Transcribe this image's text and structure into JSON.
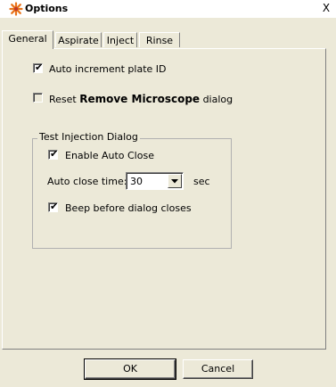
{
  "window": {
    "title": "Options",
    "close_glyph": "X"
  },
  "tabs": [
    {
      "label": "General",
      "active": true
    },
    {
      "label": "Aspirate",
      "active": false
    },
    {
      "label": "Inject",
      "active": false
    },
    {
      "label": "Rinse",
      "active": false
    }
  ],
  "general": {
    "auto_increment": {
      "label": "Auto increment plate ID",
      "checked": true
    },
    "reset": {
      "prefix": "Reset",
      "bold": "Remove Microscope",
      "suffix": "dialog",
      "checked": false,
      "disabled": true
    },
    "test_injection": {
      "title": "Test Injection Dialog",
      "enable_auto_close": {
        "label": "Enable Auto Close",
        "checked": true
      },
      "auto_close_time_label": "Auto close time:",
      "auto_close_time_value": "30",
      "auto_close_time_unit": "sec",
      "beep": {
        "label": "Beep before dialog closes",
        "checked": true
      }
    }
  },
  "buttons": {
    "ok": "OK",
    "cancel": "Cancel"
  },
  "icons": {
    "title_icon": "options-star-icon",
    "close_icon": "close-icon",
    "dropdown_icon": "chevron-down-icon",
    "check_icon": "checkmark-icon"
  },
  "colors": {
    "face": "#ece9d8",
    "title_icon_color": "#e8731a"
  }
}
